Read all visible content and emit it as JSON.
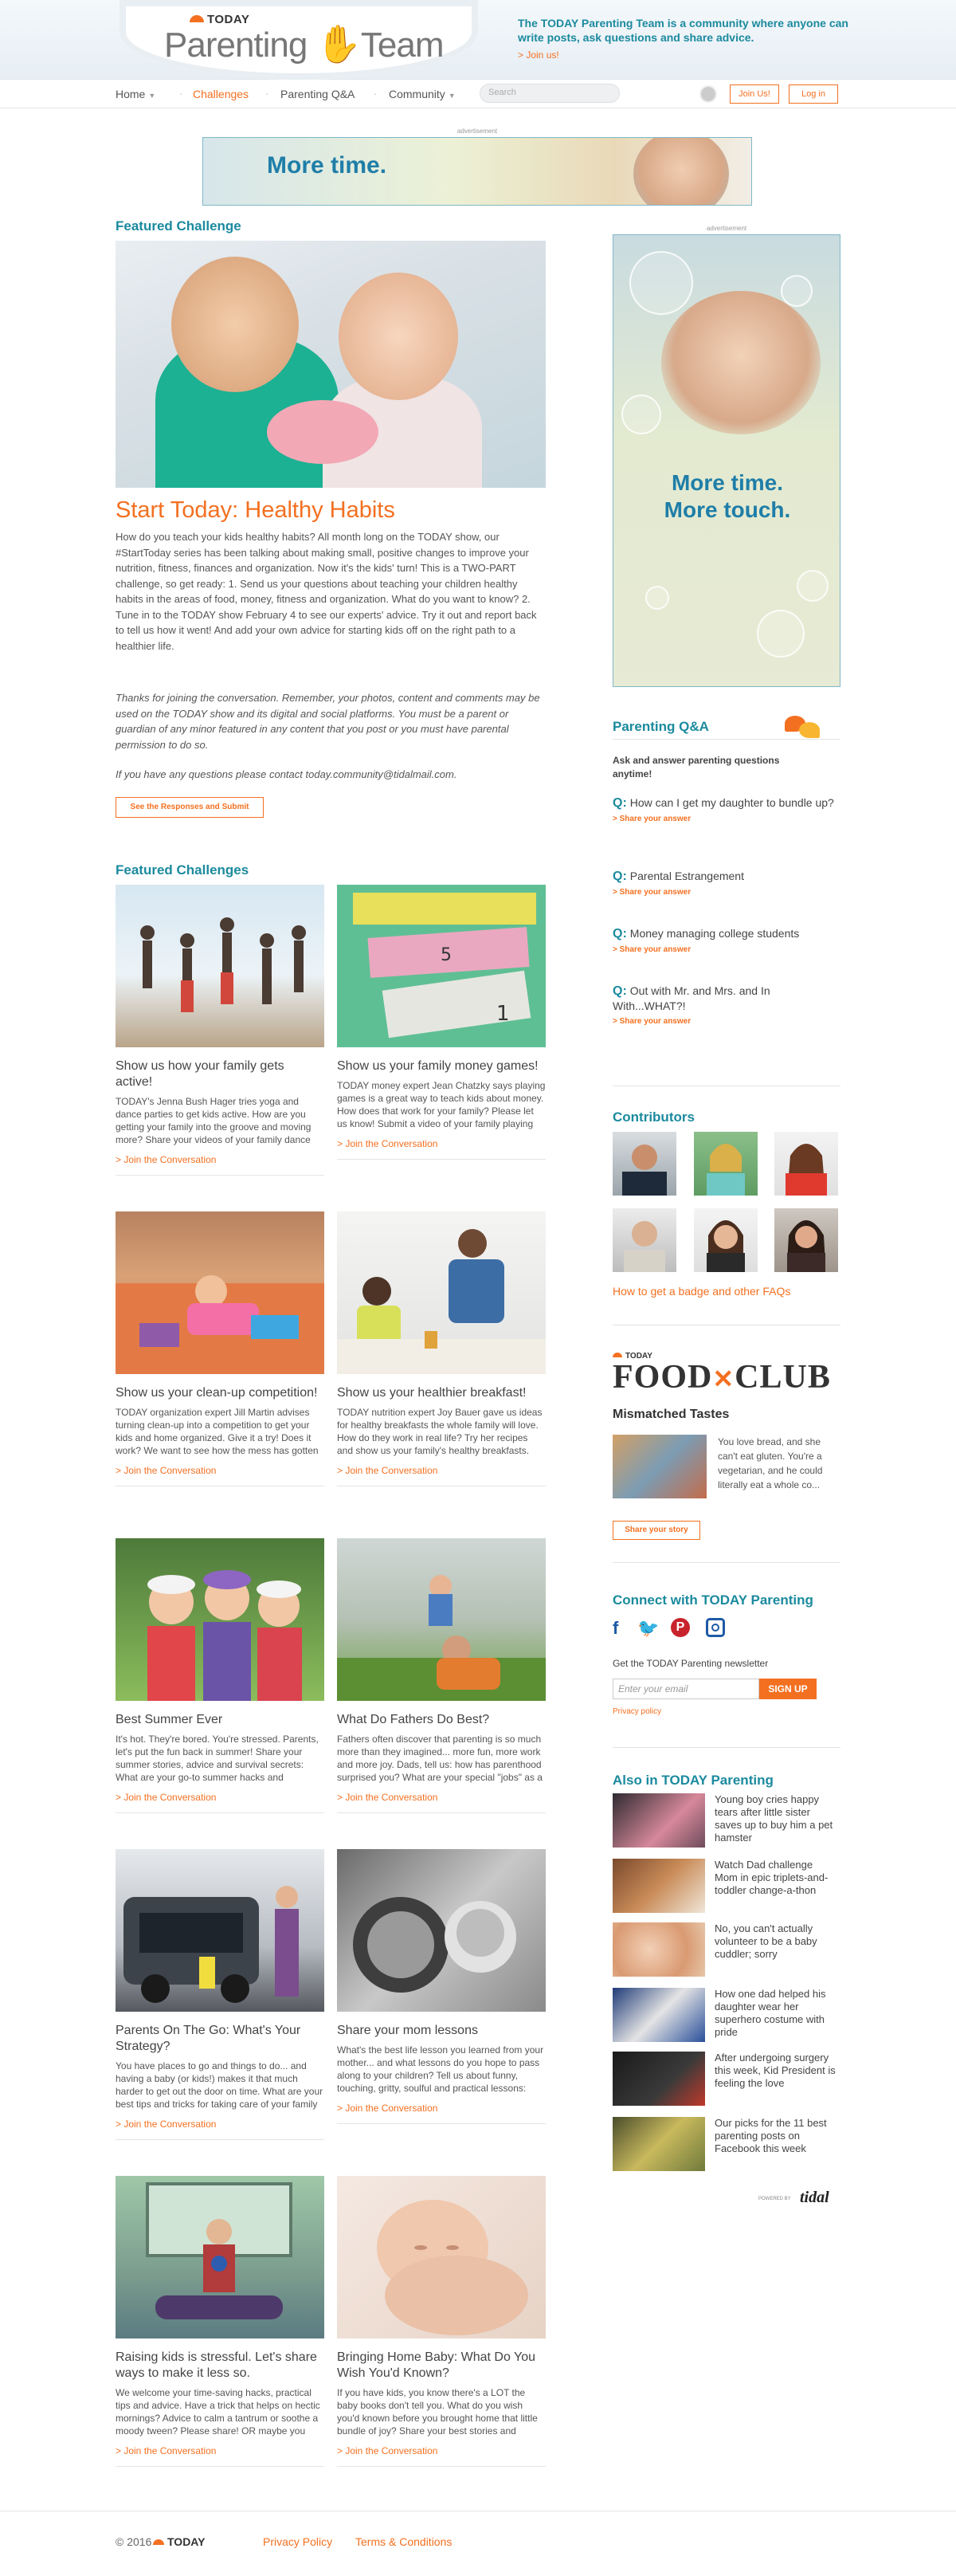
{
  "header": {
    "brand_small": "TODAY",
    "brand_main_left": "Parenting",
    "brand_main_right": "Team",
    "tagline": "The TODAY Parenting Team is a community where anyone can write posts, ask questions and share advice.",
    "join_link": "> Join us!"
  },
  "nav": {
    "items": [
      {
        "label": "Home"
      },
      {
        "label": "Challenges"
      },
      {
        "label": "Parenting Q&A"
      },
      {
        "label": "Community"
      }
    ],
    "search_placeholder": "Search",
    "join_button": "Join Us!",
    "login_button": "Log in"
  },
  "ads": {
    "label": "advertisement",
    "banner_text": "More time.",
    "side_text_1": "More time.",
    "side_text_2": "More touch."
  },
  "featured": {
    "section_title": "Featured Challenge",
    "title": "Start Today: Healthy Habits",
    "body": "How do you teach your kids healthy habits? All month long on the TODAY show, our #StartToday series has been talking about making small, positive changes to improve your nutrition, fitness, finances and organization. Now it's the kids' turn! This is a TWO-PART challenge, so get ready: 1. Send us your questions about teaching your children healthy habits in the areas of food, money, fitness and organization. What do you want to know? 2. Tune in to the TODAY show February 4 to see our experts' advice. Try it out and report back to tell us how it went! And add your own advice for starting kids off on the right path to a healthier life.",
    "italic": "Thanks for joining the conversation. Remember, your photos, content and comments may be used on the TODAY show and its digital and social platforms. You must be a parent or guardian of any minor featured in any content that you post or you must have parental permission to do so.",
    "contact_prefix": "If you have any questions please contact ",
    "contact_email": "today.community@tidalmail.com.",
    "button": "See the Responses and Submit"
  },
  "challenges": {
    "section_title": "Featured Challenges",
    "join_label": "> Join the Conversation",
    "cards": [
      {
        "title": "Show us how your family gets active!",
        "desc": "TODAY's Jenna Bush Hager tries yoga and dance parties to get kids active. How are you getting your family into the groove and moving more? Share your videos of your family dance sessions or dance..."
      },
      {
        "title": "Show us your family money games!",
        "desc": "TODAY money expert Jean Chatzky says playing games is a great way to teach kids about money. How does that work for your family? Please let us know! Submit a video of your family playing money games,..."
      },
      {
        "title": "Show us your clean-up competition!",
        "desc": "TODAY organization expert Jill Martin advises turning clean-up into a competition to get your kids and home organized. Give it a try! Does it work? We want to see how the mess has gotten cleaned up..."
      },
      {
        "title": "Show us your healthier breakfast!",
        "desc": "TODAY nutrition expert Joy Bauer gave us ideas for healthy breakfasts the whole family will love. How do they work in real life? Try her recipes and show us your family's healthy breakfasts. We want..."
      },
      {
        "title": "Best Summer Ever",
        "desc": "It's hot. They're bored. You're stressed. Parents, let's put the fun back in summer! Share your summer stories, advice and survival secrets: What are your go-to summer hacks and activities? What are..."
      },
      {
        "title": "What Do Fathers Do Best?",
        "desc": "Fathers often discover that parenting is so much more than they imagined... more fun, more work and more joy. Dads, tell us: how has parenthood surprised you? What are your special \"jobs\" as a father,..."
      },
      {
        "title": "Parents On The Go: What's Your Strategy?",
        "desc": "You have places to go and things to do... and having a baby (or kids!) makes it that much harder to get out the door on time. What are your best tips and tricks for taking care of your family on the go?..."
      },
      {
        "title": "Share your mom lessons",
        "desc": "What's the best life lesson you learned from your mother... and what lessons do you hope to pass along to your children? Tell us about funny, touching, gritty, soulful and practical lessons: how did..."
      },
      {
        "title": "Raising kids is stressful. Let's share ways to make it less so.",
        "desc": "We welcome your time-saving hacks, practical tips and advice. Have a trick that helps on hectic mornings? Advice to calm a tantrum or soothe a moody tween? Please share! OR maybe you have a mantra for..."
      },
      {
        "title": "Bringing Home Baby: What Do You Wish You'd Known?",
        "desc": "If you have kids, you know there's a LOT the baby books don't tell you. What do you wish you'd known before you brought home that little bundle of joy? Share your best stories and advice, whether it's..."
      }
    ]
  },
  "qa": {
    "title": "Parenting Q&A",
    "subtitle": "Ask and answer parenting questions anytime!",
    "q_marker": "Q:",
    "share_label": "> Share your answer",
    "questions": [
      {
        "text": "How can I get my daughter to bundle up?"
      },
      {
        "text": "Parental Estrangement"
      },
      {
        "text": "Money managing college students"
      },
      {
        "text": "Out with Mr. and Mrs. and In With...WHAT?!"
      }
    ]
  },
  "contributors": {
    "title": "Contributors",
    "badge_link": "How to get a badge and other FAQs"
  },
  "foodclub": {
    "small": "TODAY",
    "logo_left": "FOOD",
    "logo_right": "CLUB",
    "heading": "Mismatched Tastes",
    "text": "You love bread, and she can't eat gluten. You're a vegetarian, and he could literally eat a whole co...",
    "button": "Share your story"
  },
  "connect": {
    "title": "Connect with TODAY Parenting",
    "newsletter_label": "Get the TODAY Parenting newsletter",
    "email_placeholder": "Enter your email",
    "signup_button": "SIGN UP",
    "privacy": "Privacy policy"
  },
  "also": {
    "title": "Also in TODAY Parenting",
    "items": [
      {
        "text": "Young boy cries happy tears after little sister saves up to buy him a pet hamster"
      },
      {
        "text": "Watch Dad challenge Mom in epic triplets-and-toddler change-a-thon"
      },
      {
        "text": "No, you can't actually volunteer to be a baby cuddler; sorry"
      },
      {
        "text": "How one dad helped his daughter wear her superhero costume with pride"
      },
      {
        "text": "After undergoing surgery this week, Kid President is feeling the love"
      },
      {
        "text": "Our picks for the 11 best parenting posts on Facebook this week"
      }
    ],
    "powered_small": "POWERED BY",
    "powered_brand": "tidal"
  },
  "footer": {
    "copyright": "© 2016",
    "brand": "TODAY",
    "privacy": "Privacy Policy",
    "terms": "Terms & Conditions"
  },
  "colors": {
    "accent": "#f37021",
    "teal": "#1b8a9e"
  }
}
